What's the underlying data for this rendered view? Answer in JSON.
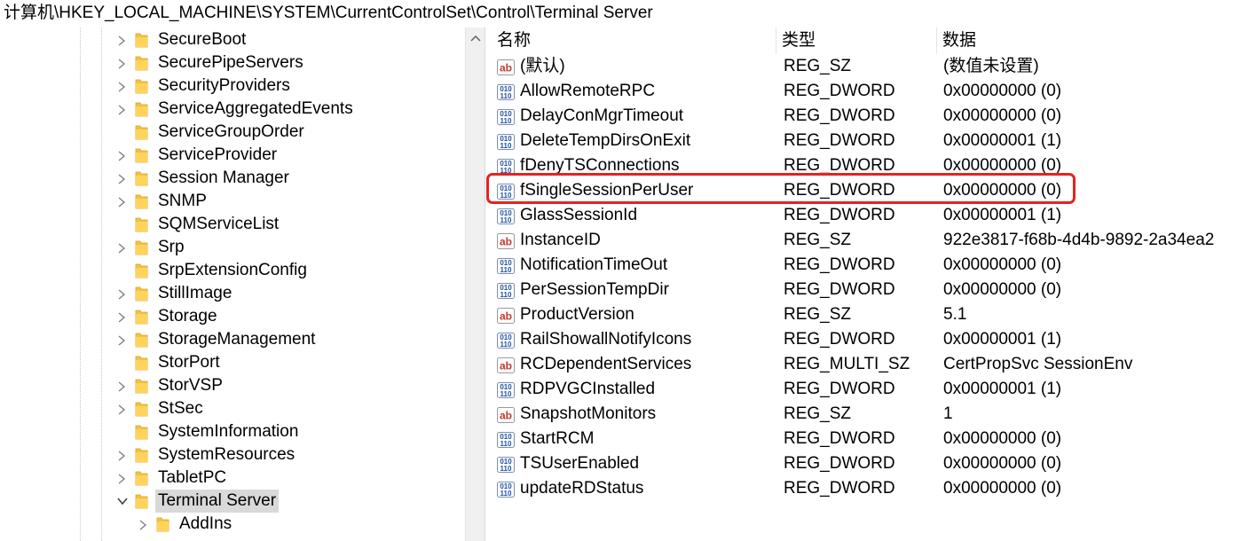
{
  "address_bar": {
    "path": "计算机\\HKEY_LOCAL_MACHINE\\SYSTEM\\CurrentControlSet\\Control\\Terminal Server"
  },
  "tree": {
    "items": [
      {
        "label": "SecureBoot",
        "expandable": true
      },
      {
        "label": "SecurePipeServers",
        "expandable": true
      },
      {
        "label": "SecurityProviders",
        "expandable": true
      },
      {
        "label": "ServiceAggregatedEvents",
        "expandable": true
      },
      {
        "label": "ServiceGroupOrder",
        "expandable": false
      },
      {
        "label": "ServiceProvider",
        "expandable": true
      },
      {
        "label": "Session Manager",
        "expandable": true
      },
      {
        "label": "SNMP",
        "expandable": true
      },
      {
        "label": "SQMServiceList",
        "expandable": false
      },
      {
        "label": "Srp",
        "expandable": true
      },
      {
        "label": "SrpExtensionConfig",
        "expandable": false
      },
      {
        "label": "StillImage",
        "expandable": true
      },
      {
        "label": "Storage",
        "expandable": true
      },
      {
        "label": "StorageManagement",
        "expandable": true
      },
      {
        "label": "StorPort",
        "expandable": false
      },
      {
        "label": "StorVSP",
        "expandable": true
      },
      {
        "label": "StSec",
        "expandable": true
      },
      {
        "label": "SystemInformation",
        "expandable": false
      },
      {
        "label": "SystemResources",
        "expandable": true
      },
      {
        "label": "TabletPC",
        "expandable": true
      },
      {
        "label": "Terminal Server",
        "expandable": true,
        "expanded": true,
        "selected": true
      },
      {
        "label": "AddIns",
        "expandable": true,
        "child": true
      }
    ]
  },
  "list": {
    "headers": {
      "name": "名称",
      "type": "类型",
      "data": "数据"
    },
    "rows": [
      {
        "icon": "string-value-icon",
        "name": "(默认)",
        "type": "REG_SZ",
        "data": "(数值未设置)"
      },
      {
        "icon": "binary-value-icon",
        "name": "AllowRemoteRPC",
        "type": "REG_DWORD",
        "data": "0x00000000 (0)"
      },
      {
        "icon": "binary-value-icon",
        "name": "DelayConMgrTimeout",
        "type": "REG_DWORD",
        "data": "0x00000000 (0)"
      },
      {
        "icon": "binary-value-icon",
        "name": "DeleteTempDirsOnExit",
        "type": "REG_DWORD",
        "data": "0x00000001 (1)"
      },
      {
        "icon": "binary-value-icon",
        "name": "fDenyTSConnections",
        "type": "REG_DWORD",
        "data": "0x00000000 (0)"
      },
      {
        "icon": "binary-value-icon",
        "name": "fSingleSessionPerUser",
        "type": "REG_DWORD",
        "data": "0x00000000 (0)"
      },
      {
        "icon": "binary-value-icon",
        "name": "GlassSessionId",
        "type": "REG_DWORD",
        "data": "0x00000001 (1)"
      },
      {
        "icon": "string-value-icon",
        "name": "InstanceID",
        "type": "REG_SZ",
        "data": "922e3817-f68b-4d4b-9892-2a34ea2"
      },
      {
        "icon": "binary-value-icon",
        "name": "NotificationTimeOut",
        "type": "REG_DWORD",
        "data": "0x00000000 (0)"
      },
      {
        "icon": "binary-value-icon",
        "name": "PerSessionTempDir",
        "type": "REG_DWORD",
        "data": "0x00000000 (0)"
      },
      {
        "icon": "string-value-icon",
        "name": "ProductVersion",
        "type": "REG_SZ",
        "data": "5.1"
      },
      {
        "icon": "binary-value-icon",
        "name": "RailShowallNotifyIcons",
        "type": "REG_DWORD",
        "data": "0x00000001 (1)"
      },
      {
        "icon": "string-value-icon",
        "name": "RCDependentServices",
        "type": "REG_MULTI_SZ",
        "data": "CertPropSvc SessionEnv"
      },
      {
        "icon": "binary-value-icon",
        "name": "RDPVGCInstalled",
        "type": "REG_DWORD",
        "data": "0x00000001 (1)"
      },
      {
        "icon": "string-value-icon",
        "name": "SnapshotMonitors",
        "type": "REG_SZ",
        "data": "1"
      },
      {
        "icon": "binary-value-icon",
        "name": "StartRCM",
        "type": "REG_DWORD",
        "data": "0x00000000 (0)"
      },
      {
        "icon": "binary-value-icon",
        "name": "TSUserEnabled",
        "type": "REG_DWORD",
        "data": "0x00000000 (0)"
      },
      {
        "icon": "binary-value-icon",
        "name": "updateRDStatus",
        "type": "REG_DWORD",
        "data": "0x00000000 (0)"
      }
    ]
  },
  "colors": {
    "highlight_border": "#e8211d",
    "folder": "#f5c242",
    "selection": "#d9d9d9"
  }
}
